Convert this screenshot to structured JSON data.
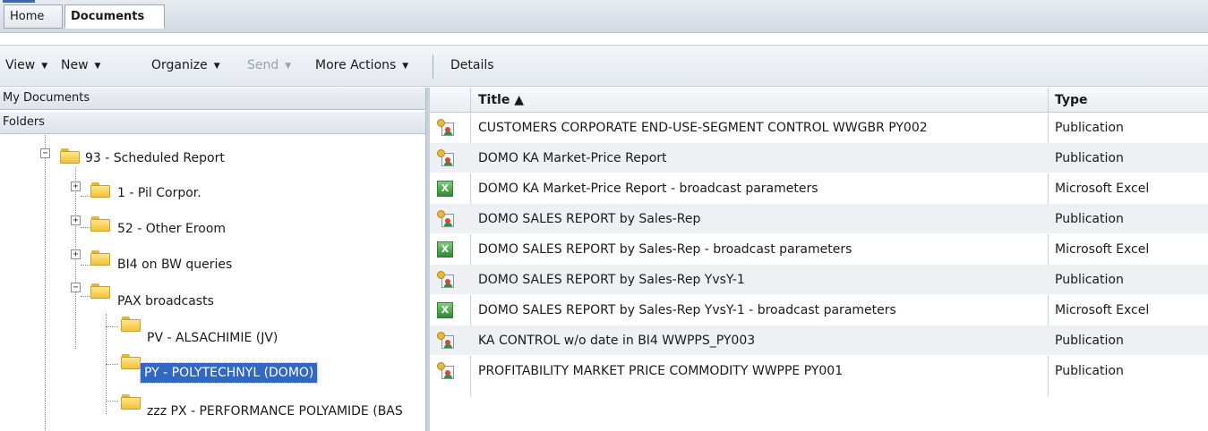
{
  "tabs": {
    "home": "Home",
    "documents": "Documents"
  },
  "toolbar": {
    "view": "View",
    "new": "New",
    "organize": "Organize",
    "send": "Send",
    "more_actions": "More Actions",
    "details": "Details",
    "arrow": "▼"
  },
  "left_panel": {
    "my_documents": "My Documents",
    "folders": "Folders",
    "tree": [
      {
        "label": "93 - Scheduled Report",
        "expander": "−"
      },
      {
        "label": "1 - Pil Corpor.",
        "expander": "+"
      },
      {
        "label": "52 - Other Eroom",
        "expander": "+"
      },
      {
        "label": "BI4 on BW queries",
        "expander": "+"
      },
      {
        "label": "PAX broadcasts",
        "expander": "−"
      },
      {
        "label": "PV - ALSACHIMIE (JV)"
      },
      {
        "label": "PY - POLYTECHNYL (DOMO)",
        "selected": true
      },
      {
        "label": "zzz PX - PERFORMANCE POLYAMIDE (BAS"
      }
    ]
  },
  "table": {
    "columns": {
      "title": "Title ▲",
      "type": "Type"
    },
    "rows": [
      {
        "icon": "publication-icon",
        "title": "CUSTOMERS CORPORATE END-USE-SEGMENT CONTROL WWGBR PY002",
        "type": "Publication"
      },
      {
        "icon": "publication-icon",
        "title": "DOMO KA Market-Price Report",
        "type": "Publication"
      },
      {
        "icon": "excel-icon",
        "title": "DOMO KA Market-Price Report - broadcast parameters",
        "type": "Microsoft Excel"
      },
      {
        "icon": "publication-icon",
        "title": "DOMO SALES REPORT by Sales-Rep",
        "type": "Publication"
      },
      {
        "icon": "excel-icon",
        "title": "DOMO SALES REPORT by Sales-Rep - broadcast parameters",
        "type": "Microsoft Excel"
      },
      {
        "icon": "publication-icon",
        "title": "DOMO SALES REPORT by Sales-Rep YvsY-1",
        "type": "Publication"
      },
      {
        "icon": "excel-icon",
        "title": "DOMO SALES REPORT by Sales-Rep YvsY-1 - broadcast parameters",
        "type": "Microsoft Excel"
      },
      {
        "icon": "publication-icon",
        "title": "KA CONTROL w/o date in BI4 WWPPS_PY003",
        "type": "Publication"
      },
      {
        "icon": "publication-icon",
        "title": "PROFITABILITY MARKET PRICE COMMODITY WWPPE PY001",
        "type": "Publication"
      }
    ]
  }
}
